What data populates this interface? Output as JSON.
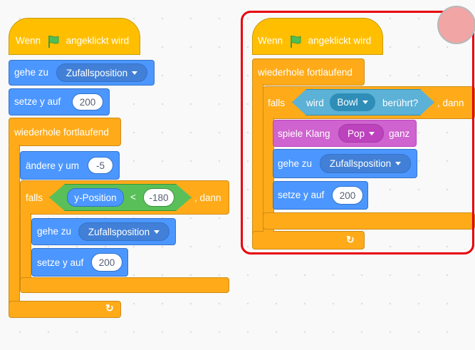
{
  "left_script": {
    "hat_pre": "Wenn",
    "hat_post": "angeklickt wird",
    "goto_label": "gehe zu",
    "goto_menu": "Zufallsposition",
    "sety_label": "setze y auf",
    "sety_value": "200",
    "forever_label": "wiederhole fortlaufend",
    "change_label": "ändere y um",
    "change_value": "-5",
    "if_label": "falls",
    "then_label": ", dann",
    "ypos_reporter": "y-Position",
    "less_than": "<",
    "threshold": "-180",
    "inner_goto_label": "gehe zu",
    "inner_goto_menu": "Zufallsposition",
    "inner_sety_label": "setze y auf",
    "inner_sety_value": "200",
    "loop_arrow": "↻"
  },
  "right_script": {
    "hat_pre": "Wenn",
    "hat_post": "angeklickt wird",
    "forever_label": "wiederhole fortlaufend",
    "if_label": "falls",
    "touching_pre": "wird",
    "touching_menu": "Bowl",
    "touching_post": "berührt?",
    "then_label": ", dann",
    "sound_label": "spiele Klang",
    "sound_menu": "Pop",
    "sound_post": "ganz",
    "goto_label": "gehe zu",
    "goto_menu": "Zufallsposition",
    "sety_label": "setze y auf",
    "sety_value": "200",
    "loop_arrow": "↻"
  },
  "colors": {
    "events": "#ffbf00",
    "control": "#ffab19",
    "motion": "#4c97ff",
    "sound": "#cf63cf",
    "operators": "#59c059",
    "sensing": "#5cb1d6",
    "highlight": "#e8000a"
  }
}
